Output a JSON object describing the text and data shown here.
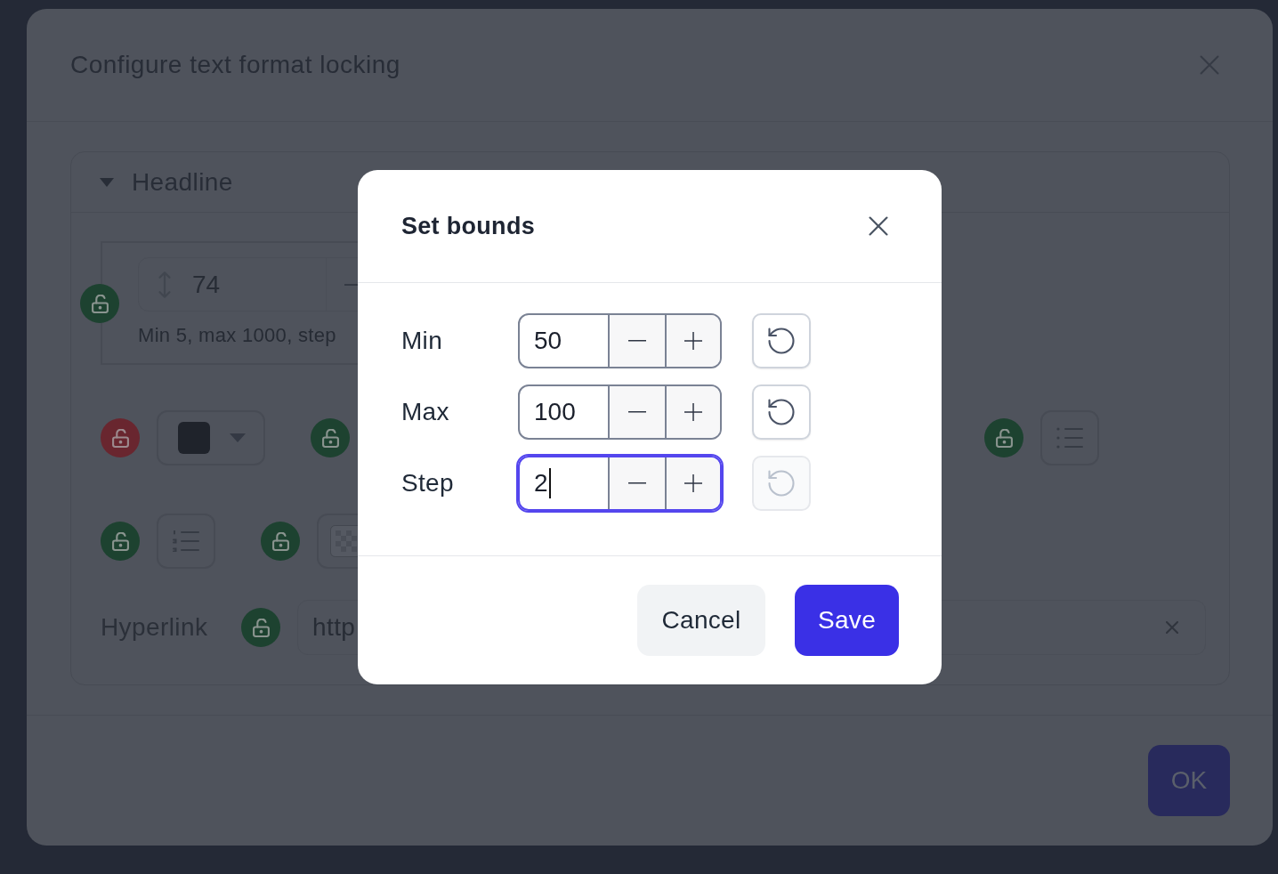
{
  "background_dialog": {
    "title": "Configure text format locking",
    "section": {
      "title": "Headline",
      "expanded": true,
      "size_field": {
        "value": "74",
        "hint": "Min 5, max 1000, step",
        "locked": false
      },
      "format_rows": [
        [
          {
            "kind": "color",
            "locked": true,
            "color": "#1f232b"
          },
          {
            "kind": "lock",
            "locked": false
          },
          {
            "kind": "bullet_list",
            "locked": false
          }
        ],
        [
          {
            "kind": "numbered_list",
            "locked": false
          },
          {
            "kind": "transparency",
            "locked": false
          }
        ]
      ],
      "hyperlink": {
        "label": "Hyperlink",
        "locked": false,
        "value": "http"
      }
    },
    "ok_button": "OK"
  },
  "modal": {
    "title": "Set bounds",
    "fields": [
      {
        "label": "Min",
        "value": "50",
        "focused": false,
        "reset_disabled": false
      },
      {
        "label": "Max",
        "value": "100",
        "focused": false,
        "reset_disabled": false
      },
      {
        "label": "Step",
        "value": "2",
        "focused": true,
        "reset_disabled": true
      }
    ],
    "buttons": [
      {
        "label": "Cancel",
        "kind": "secondary"
      },
      {
        "label": "Save",
        "kind": "primary"
      }
    ]
  }
}
